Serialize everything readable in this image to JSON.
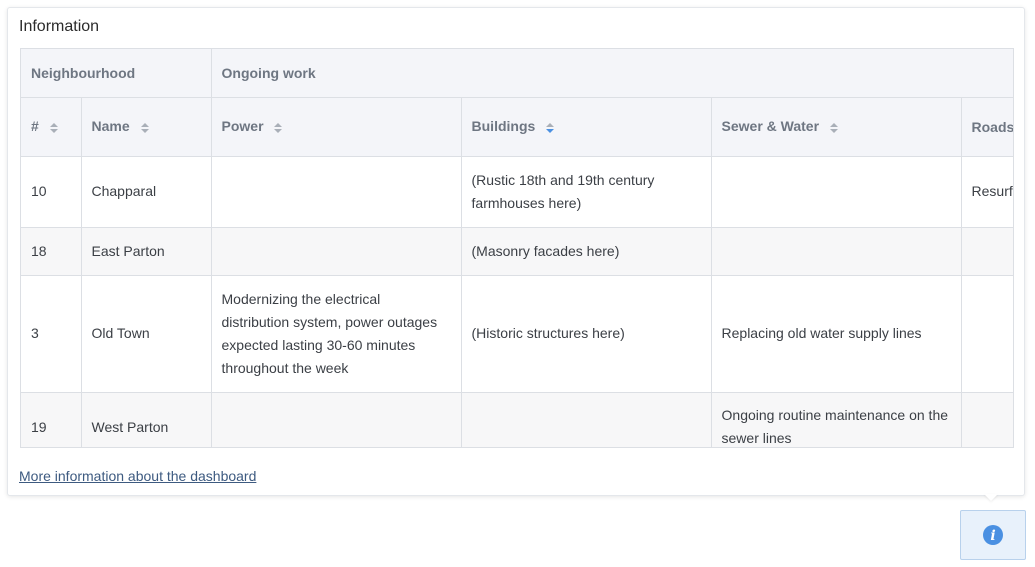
{
  "panel": {
    "title": "Information",
    "footer_link": "More information about the dashboard"
  },
  "table": {
    "group_headers": {
      "neighbourhood": "Neighbourhood",
      "ongoing_work": "Ongoing work"
    },
    "columns": {
      "num": "#",
      "name": "Name",
      "power": "Power",
      "buildings": "Buildings",
      "sewer_water": "Sewer & Water",
      "roads": "Roads"
    },
    "sorted_column": "Buildings",
    "rows": [
      {
        "num": "10",
        "name": "Chapparal",
        "power": "",
        "buildings": "(Rustic 18th and 19th century farmhouses here)",
        "sewer_water": "",
        "roads": "Resurf"
      },
      {
        "num": "18",
        "name": "East Parton",
        "power": "",
        "buildings": "(Masonry facades here)",
        "sewer_water": "",
        "roads": ""
      },
      {
        "num": "3",
        "name": "Old Town",
        "power": "Modernizing the electrical distribution system, power outages expected lasting 30-60 minutes throughout the week",
        "buildings": "(Historic structures here)",
        "sewer_water": "Replacing old water supply lines",
        "roads": ""
      },
      {
        "num": "19",
        "name": "West Parton",
        "power": "",
        "buildings": "",
        "sewer_water": "Ongoing routine maintenance on the sewer lines",
        "roads": ""
      }
    ]
  },
  "info_button": {
    "icon": "info-icon",
    "glyph": "i"
  },
  "colors": {
    "accent": "#4a90e2",
    "header_bg": "#f4f5f9",
    "link": "#3d5a80"
  }
}
